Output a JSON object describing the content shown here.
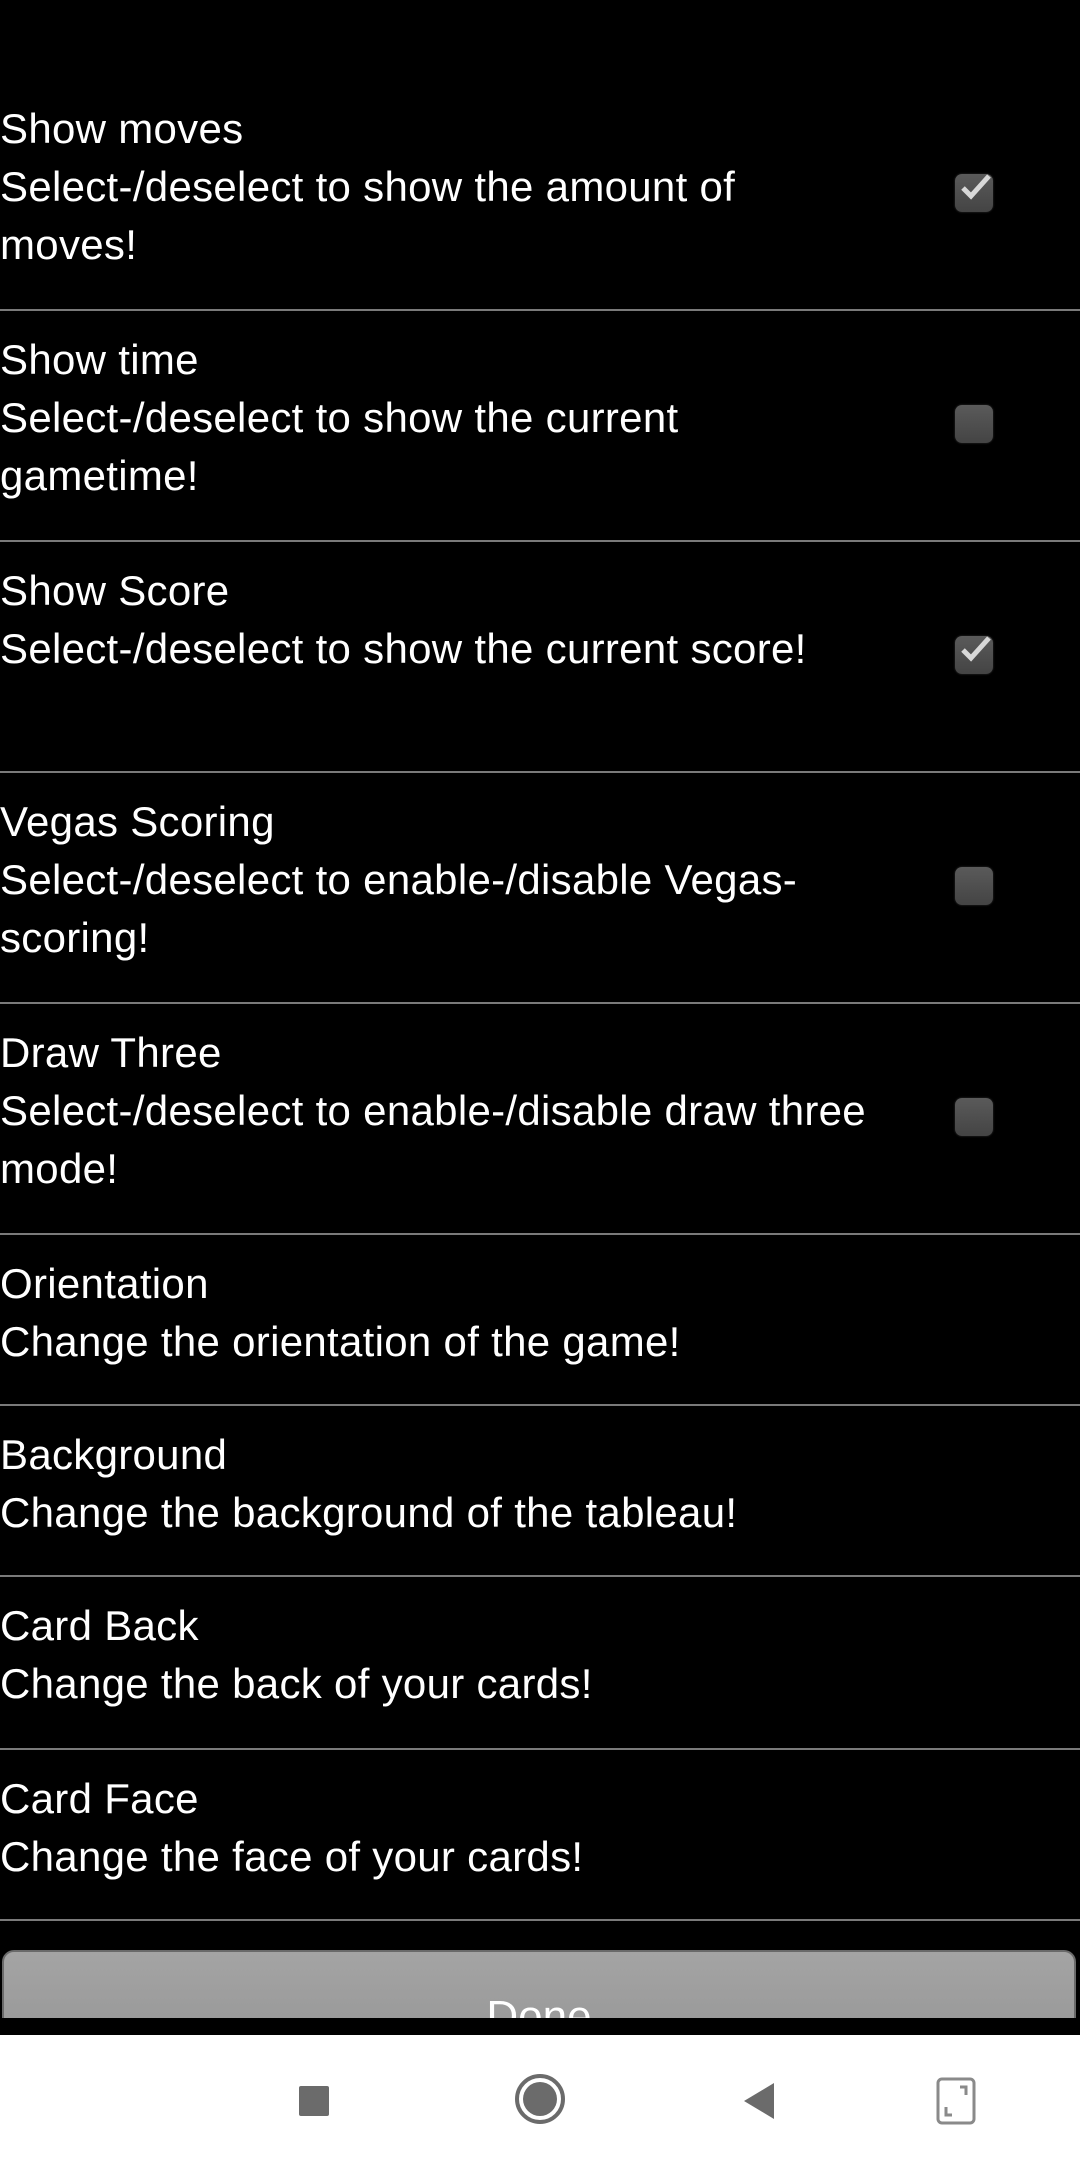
{
  "settings": [
    {
      "title": "Show moves",
      "desc": "Select-/deselect to show the amount of moves!",
      "checked": true
    },
    {
      "title": "Show time",
      "desc": "Select-/deselect to show the current gametime!",
      "checked": false
    },
    {
      "title": "Show Score",
      "desc": "Select-/deselect to show the current score!",
      "checked": true
    },
    {
      "title": "Vegas Scoring",
      "desc": "Select-/deselect to enable-/disable Vegas-scoring!",
      "checked": false
    },
    {
      "title": "Draw Three",
      "desc": "Select-/deselect to enable-/disable draw three mode!",
      "checked": false
    },
    {
      "title": "Orientation",
      "desc": "Change the orientation of the game!"
    },
    {
      "title": "Background",
      "desc": "Change the background of the tableau!"
    },
    {
      "title": "Card Back",
      "desc": "Change the back of your cards!"
    },
    {
      "title": "Card Face",
      "desc": "Change the face of your cards!"
    }
  ],
  "done_label": "Done",
  "nav": {
    "icons": [
      "recents-square-icon",
      "home-circle-icon",
      "back-triangle-icon",
      "rotate-screen-icon"
    ]
  }
}
